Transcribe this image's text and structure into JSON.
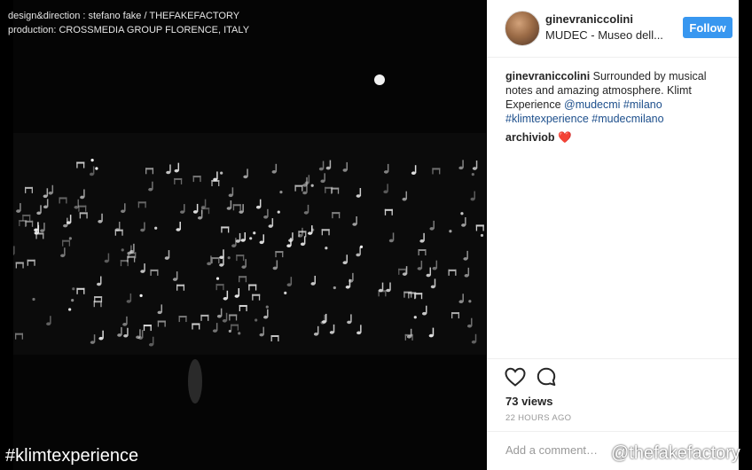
{
  "credits": {
    "line1": "design&direction : stefano fake / THEFAKEFACTORY",
    "line2": "production: CROSSMEDIA GROUP FLORENCE, ITALY"
  },
  "overlay": {
    "hashtag": "#klimtexperience",
    "handle": "@thefakefactory"
  },
  "post": {
    "username": "ginevraniccolini",
    "location": "MUDEC - Museo dell...",
    "follow_label": "Follow",
    "caption_user": "ginevraniccolini",
    "caption_text": " Surrounded by musical notes and amazing atmosphere. Klimt Experience ",
    "caption_links": [
      "@mudecmi",
      "#milano",
      "#klimtexperience",
      "#mudecmilano"
    ],
    "comment_user": "archiviob",
    "comment_text": "❤️",
    "views": "73 views",
    "time_ago": "22 HOURS AGO",
    "comment_placeholder": "Add a comment…"
  },
  "colors": {
    "follow_button": "#3897f0",
    "link": "#1d4f8c",
    "panel_bg": "#ffffff",
    "page_bg": "#000000"
  },
  "icons": {
    "like": "heart-outline-icon",
    "comment": "speech-bubble-icon"
  }
}
